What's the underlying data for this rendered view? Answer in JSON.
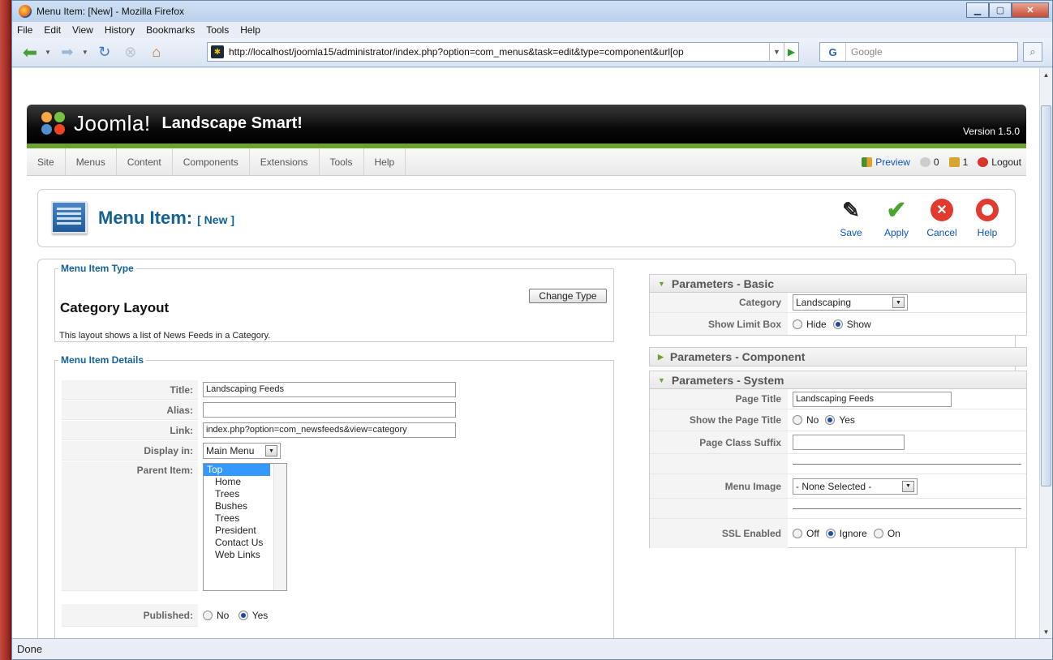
{
  "window": {
    "title": "Menu Item: [New] - Mozilla Firefox"
  },
  "browser_menu": [
    "File",
    "Edit",
    "View",
    "History",
    "Bookmarks",
    "Tools",
    "Help"
  ],
  "address_bar": {
    "url": "http://localhost/joomla15/administrator/index.php?option=com_menus&task=edit&type=component&url[op"
  },
  "search": {
    "engine": "G",
    "placeholder": "Google"
  },
  "status_bar": {
    "text": "Done"
  },
  "joomla": {
    "logo_text": "Joomla!",
    "site_name": "Landscape Smart!",
    "version": "Version 1.5.0",
    "menu": [
      "Site",
      "Menus",
      "Content",
      "Components",
      "Extensions",
      "Tools",
      "Help"
    ],
    "status": {
      "preview": "Preview",
      "messages": "0",
      "users": "1",
      "logout": "Logout"
    }
  },
  "toolbar": {
    "title": "Menu Item:",
    "subtitle": "[ New ]",
    "buttons": [
      {
        "label": "Save",
        "icon": "save-icon"
      },
      {
        "label": "Apply",
        "icon": "apply-icon"
      },
      {
        "label": "Cancel",
        "icon": "cancel-icon"
      },
      {
        "label": "Help",
        "icon": "help-icon"
      }
    ]
  },
  "menu_item_type": {
    "legend": "Menu Item Type",
    "change_type": "Change Type",
    "layout": "Category Layout",
    "description": "This layout shows a list of News Feeds in a Category."
  },
  "menu_item_details": {
    "legend": "Menu Item Details",
    "title_label": "Title:",
    "title_value": "Landscaping Feeds",
    "alias_label": "Alias:",
    "alias_value": "",
    "link_label": "Link:",
    "link_value": "index.php?option=com_newsfeeds&view=category",
    "display_label": "Display in:",
    "display_value": "Main Menu",
    "parent_label": "Parent Item:",
    "parent_items": [
      "Top",
      "Home",
      "Trees",
      "Bushes",
      "Trees",
      "President",
      "Contact Us",
      "Web Links"
    ],
    "published_label": "Published:",
    "no": "No",
    "yes": "Yes"
  },
  "params_basic": {
    "header": "Parameters - Basic",
    "category_label": "Category",
    "category_value": "Landscaping",
    "limit_label": "Show Limit Box",
    "hide": "Hide",
    "show": "Show"
  },
  "params_component": {
    "header": "Parameters - Component"
  },
  "params_system": {
    "header": "Parameters - System",
    "page_title_label": "Page Title",
    "page_title_value": "Landscaping Feeds",
    "show_title_label": "Show the Page Title",
    "no": "No",
    "yes": "Yes",
    "class_suffix_label": "Page Class Suffix",
    "menu_image_label": "Menu Image",
    "menu_image_value": "- None Selected -",
    "ssl_label": "SSL Enabled",
    "off": "Off",
    "ignore": "Ignore",
    "on": "On"
  }
}
